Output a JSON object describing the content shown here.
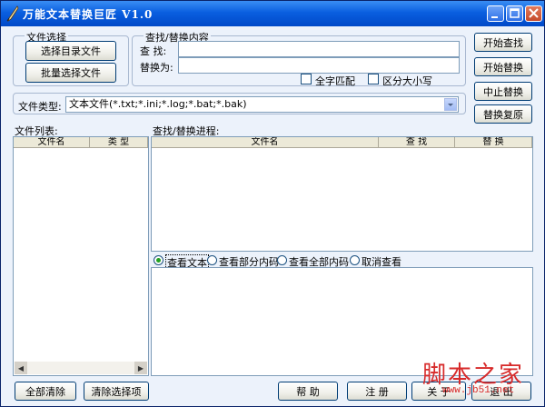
{
  "window": {
    "title": "万能文本替换巨匠  V1.0"
  },
  "file_select": {
    "legend": "文件选择",
    "select_dir_button": "选择目录文件",
    "batch_select_button": "批量选择文件"
  },
  "find_replace": {
    "legend": "查找/替换内容",
    "find_label": "查 找:",
    "replace_label": "替换为:",
    "find_value": "",
    "replace_value": "",
    "whole_word": "全字匹配",
    "match_case": "区分大小写"
  },
  "actions": {
    "start_find": "开始查找",
    "start_replace": "开始替换",
    "stop_replace": "中止替换",
    "restore": "替换复原"
  },
  "file_type": {
    "label": "文件类型:",
    "value": "文本文件(*.txt;*.ini;*.log;*.bat;*.bak)"
  },
  "file_list": {
    "label": "文件列表:",
    "columns": [
      "文件名",
      "类 型"
    ]
  },
  "progress": {
    "label": "查找/替换进程:",
    "columns": [
      "文件名",
      "查 找",
      "替 换"
    ]
  },
  "view_options": {
    "text": "查看文本",
    "partial": "查看部分内码",
    "all": "查看全部内码",
    "cancel": "取消查看",
    "selected": "text"
  },
  "bottom": {
    "clear_all": "全部清除",
    "clear_selected": "清除选择项",
    "help": "帮 助",
    "register": "注 册",
    "about": "关 于",
    "exit": "退 出"
  },
  "watermark": {
    "brand": "脚本之家",
    "url": "www.jb51.net"
  }
}
